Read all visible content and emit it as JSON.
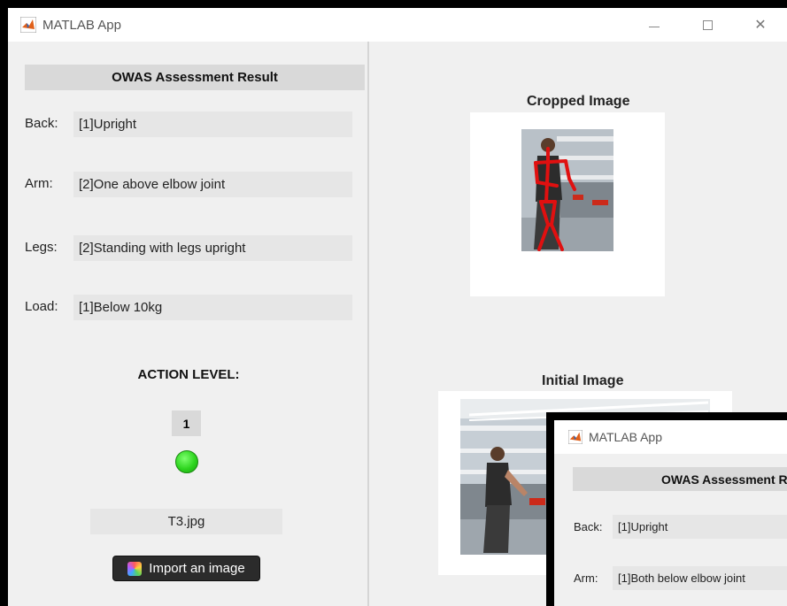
{
  "window": {
    "title": "MATLAB App",
    "minimize_glyph": "—",
    "maximize_glyph": "☐",
    "close_glyph": "✕"
  },
  "left": {
    "header": "OWAS Assessment Result",
    "rows": [
      {
        "label": "Back:",
        "value": "[1]Upright"
      },
      {
        "label": "Arm:",
        "value": "[2]One above elbow joint"
      },
      {
        "label": "Legs:",
        "value": "[2]Standing with legs upright"
      },
      {
        "label": "Load:",
        "value": "[1]Below 10kg"
      }
    ],
    "action_title": "ACTION LEVEL:",
    "action_level": "1",
    "lamp_color": "#2ed51f",
    "file_name": "T3.jpg",
    "import_label": "Import an image"
  },
  "right": {
    "cropped_title": "Cropped Image",
    "initial_title": "Initial Image",
    "skeleton_color": "#e01010"
  },
  "overlay": {
    "title": "MATLAB App",
    "header": "OWAS Assessment Resu",
    "rows": [
      {
        "label": "Back:",
        "value": "[1]Upright"
      },
      {
        "label": "Arm:",
        "value": "[1]Both below elbow joint"
      }
    ]
  }
}
